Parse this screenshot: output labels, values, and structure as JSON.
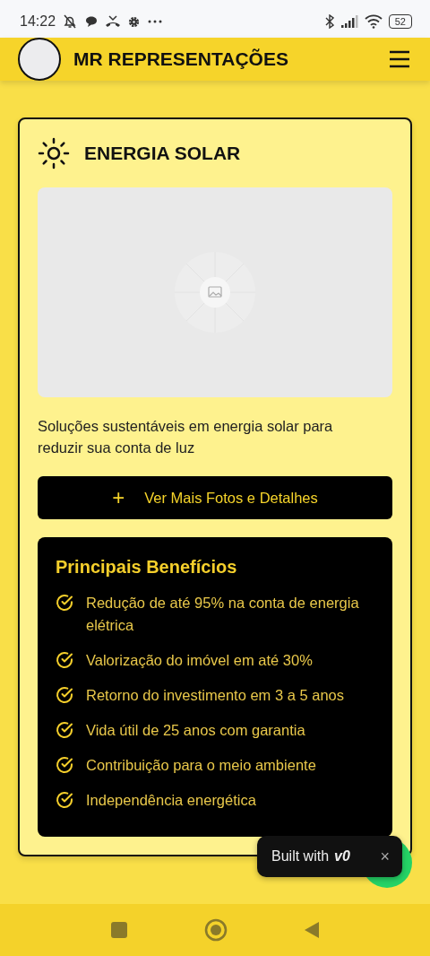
{
  "status_bar": {
    "time": "14:22",
    "battery": "52"
  },
  "header": {
    "title": "MR REPRESENTAÇÕES"
  },
  "card": {
    "title": "ENERGIA SOLAR",
    "image": {
      "kind": "placeholder"
    },
    "description": "Soluções sustentáveis em energia solar para reduzir sua conta de luz",
    "button": {
      "icon": "+",
      "label": "Ver Mais Fotos e Detalhes"
    },
    "benefits": {
      "title": "Principais Benefícios",
      "items": [
        "Redução de até 95% na conta de energia elétrica",
        "Valorização do imóvel em até 30%",
        "Retorno do investimento em 3 a 5 anos",
        "Vida útil de 25 anos com garantia",
        "Contribuição para o meio ambiente",
        "Independência energética"
      ]
    }
  },
  "badge": {
    "text": "Built with",
    "logo": "v0",
    "close": "×"
  }
}
